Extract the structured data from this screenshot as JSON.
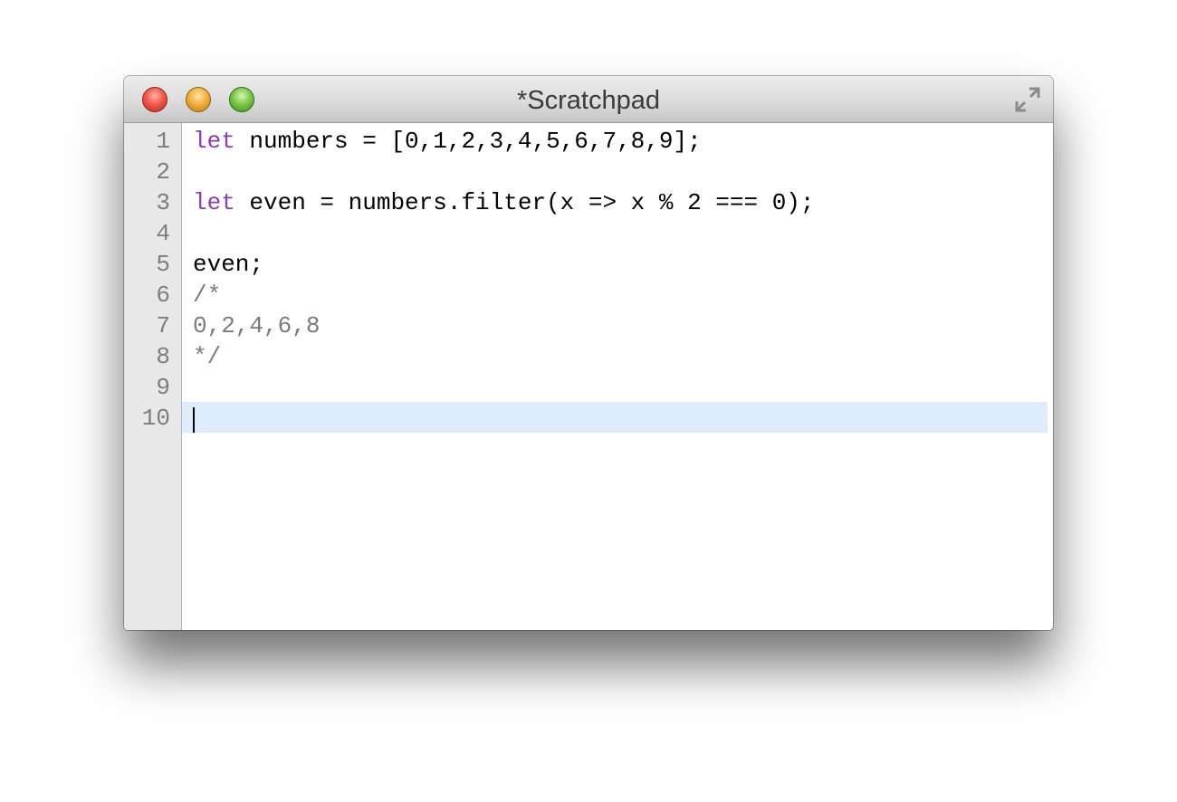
{
  "window": {
    "title": "*Scratchpad"
  },
  "icons": {
    "close": "close-button-icon",
    "minimize": "minimize-button-icon",
    "zoom": "zoom-button-icon",
    "fullscreen": "fullscreen-arrows-icon"
  },
  "colors": {
    "keyword": "#8e3cb6",
    "comment": "#7b7b7b",
    "current_line": "#dfecfb",
    "gutter": "#e8e8e8"
  },
  "editor": {
    "current_line_number": 10,
    "lines": [
      {
        "number": "1",
        "kw": "let",
        "text": " numbers = [0,1,2,3,4,5,6,7,8,9];"
      },
      {
        "number": "2",
        "kw": "",
        "text": ""
      },
      {
        "number": "3",
        "kw": "let",
        "text": " even = numbers.filter(x => x % 2 === 0);"
      },
      {
        "number": "4",
        "kw": "",
        "text": ""
      },
      {
        "number": "5",
        "kw": "",
        "text": "even;"
      },
      {
        "number": "6",
        "comment": "/*"
      },
      {
        "number": "7",
        "comment": "0,2,4,6,8"
      },
      {
        "number": "8",
        "comment": "*/"
      },
      {
        "number": "9",
        "kw": "",
        "text": ""
      },
      {
        "number": "10",
        "kw": "",
        "text": ""
      }
    ]
  }
}
